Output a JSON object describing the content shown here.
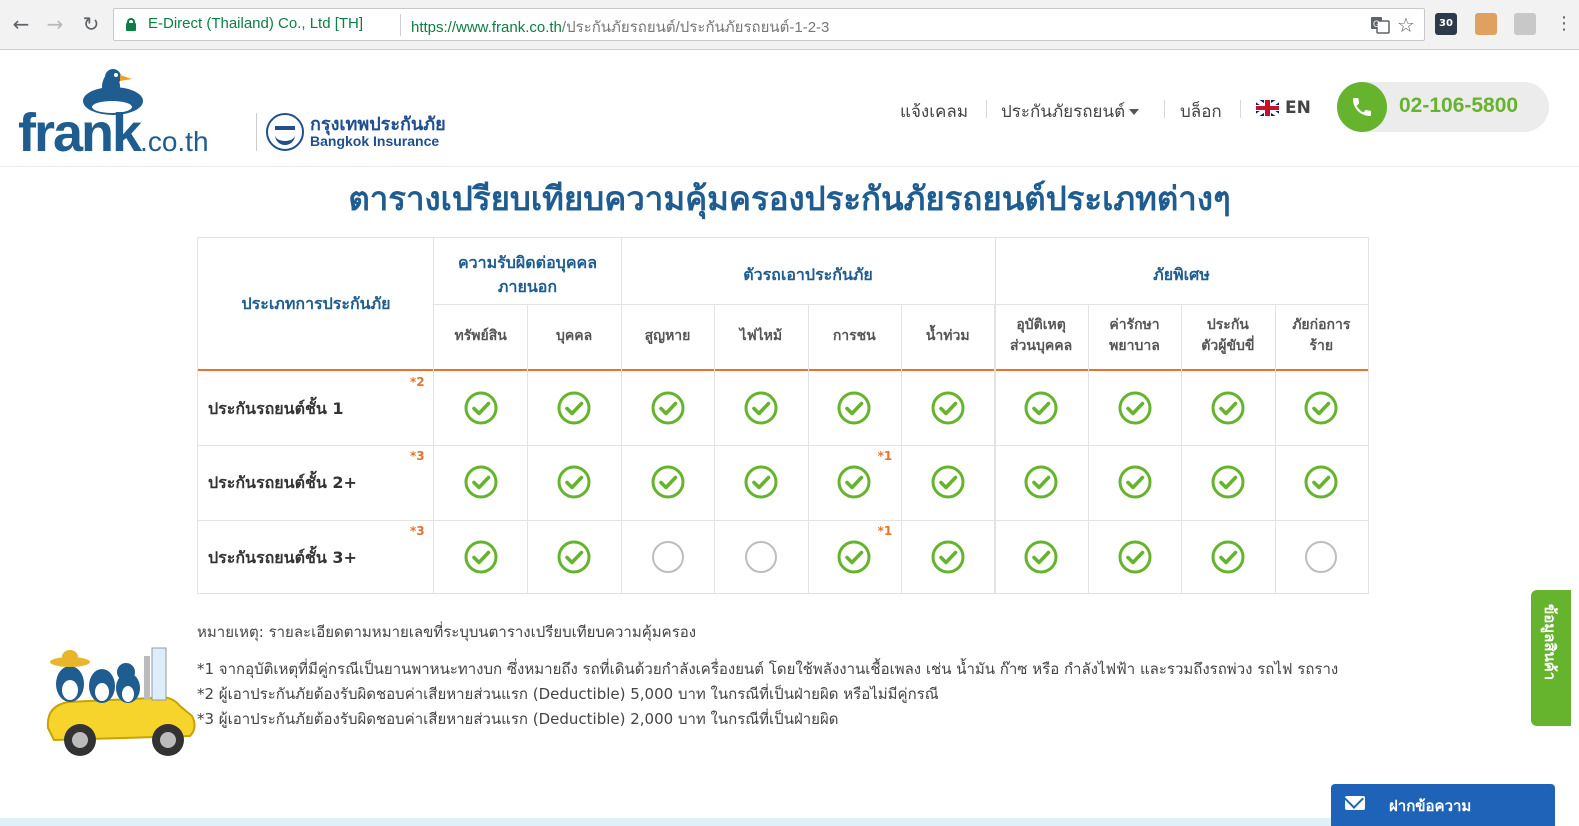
{
  "browser": {
    "cert_label": "E-Direct (Thailand) Co., Ltd [TH]",
    "url_scheme_host": "https://www.frank.co.th",
    "url_path": "/ประกันภัยรถยนต์/ประกันภัยรถยนต์-1-2-3",
    "extension_badge": "30"
  },
  "header": {
    "logo_name": "frank",
    "logo_tld": ".co.th",
    "partner_th": "กรุงเทพประกันภัย",
    "partner_en": "Bangkok Insurance",
    "nav": [
      {
        "label": "แจ้งเคลม"
      },
      {
        "label": "ประกันภัยรถยนต์"
      },
      {
        "label": "บล็อก"
      }
    ],
    "lang": "EN",
    "phone": "02-106-5800"
  },
  "title": "ตารางเปรียบเทียบความคุ้มครองประกันภัยรถยนต์ประเภทต่างๆ",
  "table": {
    "row_header": "ประเภทการประกันภัย",
    "groups": [
      {
        "label_line1": "ความรับผิดต่อบุคคล",
        "label_line2": "ภายนอก"
      },
      {
        "label": "ตัวรถเอาประกันภัย"
      },
      {
        "label": "ภัยพิเศษ"
      }
    ],
    "columns": [
      {
        "line1": "ทรัพย์สิน",
        "line2": ""
      },
      {
        "line1": "บุคคล",
        "line2": ""
      },
      {
        "line1": "สูญหาย",
        "line2": ""
      },
      {
        "line1": "ไฟไหม้",
        "line2": ""
      },
      {
        "line1": "การชน",
        "line2": ""
      },
      {
        "line1": "น้ำท่วม",
        "line2": ""
      },
      {
        "line1": "อุบัติเหตุ",
        "line2": "ส่วนบุคคล"
      },
      {
        "line1": "ค่ารักษา",
        "line2": "พยาบาล"
      },
      {
        "line1": "ประกัน",
        "line2": "ตัวผู้ขับขี่"
      },
      {
        "line1": "ภัยก่อการ",
        "line2": "ร้าย"
      }
    ],
    "rows": [
      {
        "label": "ประกันรถยนต์ชั้น 1",
        "note": "*2",
        "collision_note": "",
        "coverage": [
          true,
          true,
          true,
          true,
          true,
          true,
          true,
          true,
          true,
          true
        ]
      },
      {
        "label": "ประกันรถยนต์ชั้น 2+",
        "note": "*3",
        "collision_note": "*1",
        "coverage": [
          true,
          true,
          true,
          true,
          true,
          true,
          true,
          true,
          true,
          true
        ]
      },
      {
        "label": "ประกันรถยนต์ชั้น 3+",
        "note": "*3",
        "collision_note": "*1",
        "coverage": [
          true,
          true,
          false,
          false,
          true,
          true,
          true,
          true,
          true,
          false
        ]
      }
    ],
    "colors": {
      "check": "#66b32e",
      "empty": "#bdbdbd",
      "header_rule": "#e8742a",
      "heading": "#1f5c8f"
    }
  },
  "notes": {
    "heading": "หมายเหตุ: รายละเอียดตามหมายเลขที่ระบุบนตารางเปรียบเทียบความคุ้มครอง",
    "note1": "*1 จากอุบัติเหตุที่มีคู่กรณีเป็นยานพาหนะทางบก ซึ่งหมายถึง รถที่เดินด้วยกำลังเครื่องยนต์ โดยใช้พลังงานเชื้อเพลง เช่น น้ำมัน ก๊าซ หรือ กำลังไฟฟ้า และรวมถึงรถพ่วง รถไฟ รถราง",
    "note2": "*2 ผู้เอาประกันภัยต้องรับผิดชอบค่าเสียหายส่วนแรก (Deductible) 5,000 บาท ในกรณีที่เป็นฝ่ายผิด หรือไม่มีคู่กรณี",
    "note3": "*3 ผู้เอาประกันภัยต้องรับผิดชอบค่าเสียหายส่วนแรก (Deductible) 2,000 บาท ในกรณีที่เป็นฝ่ายผิด"
  },
  "widgets": {
    "side_tab": "ข้อมูลสินค้า",
    "message_button": "ฝากข้อความ"
  }
}
